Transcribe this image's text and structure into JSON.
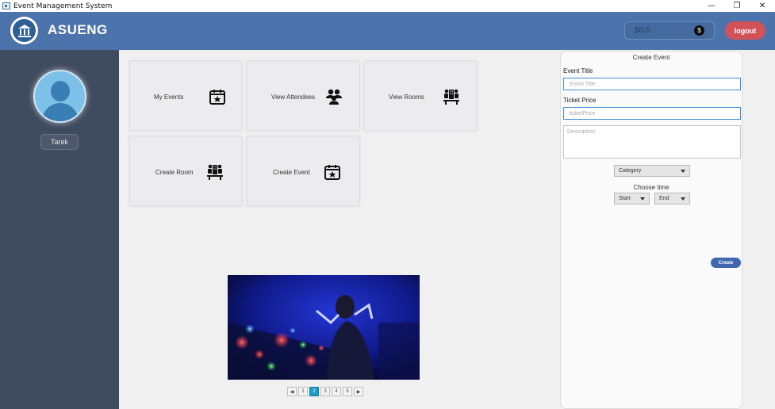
{
  "window": {
    "title": "Event Management System",
    "minimize": "—",
    "restore": "❐",
    "close": "✕"
  },
  "header": {
    "brand": "ASUENG",
    "balance": "$0.0",
    "currency_symbol": "$",
    "logout_label": "logout"
  },
  "sidebar": {
    "username": "Tarek"
  },
  "cards": [
    {
      "label": "My Events",
      "icon": "calendar-star-icon"
    },
    {
      "label": "View Attendees",
      "icon": "users-icon"
    },
    {
      "label": "View Rooms",
      "icon": "meeting-room-icon"
    },
    {
      "label": "Create Room",
      "icon": "meeting-room-icon"
    },
    {
      "label": "Create Event",
      "icon": "calendar-star-icon"
    }
  ],
  "pagination": {
    "prev": "◀",
    "next": "▶",
    "pages": [
      "1",
      "2",
      "3",
      "4",
      "5"
    ],
    "current": "2"
  },
  "create_event": {
    "title": "Create Event",
    "event_title_label": "Event Title",
    "event_title_placeholder": "Event Title",
    "ticket_price_label": "Ticket Price",
    "ticket_price_placeholder": "ticketPrice",
    "description_placeholder": "Description",
    "category": "Category",
    "choose_time_label": "Choose time",
    "start": "Start",
    "end": "End",
    "submit_label": "Create"
  },
  "colors": {
    "header": "#4c73ab",
    "sidebar": "#3f4b5e",
    "logout": "#d2525a",
    "accent": "#1e9bc8"
  }
}
